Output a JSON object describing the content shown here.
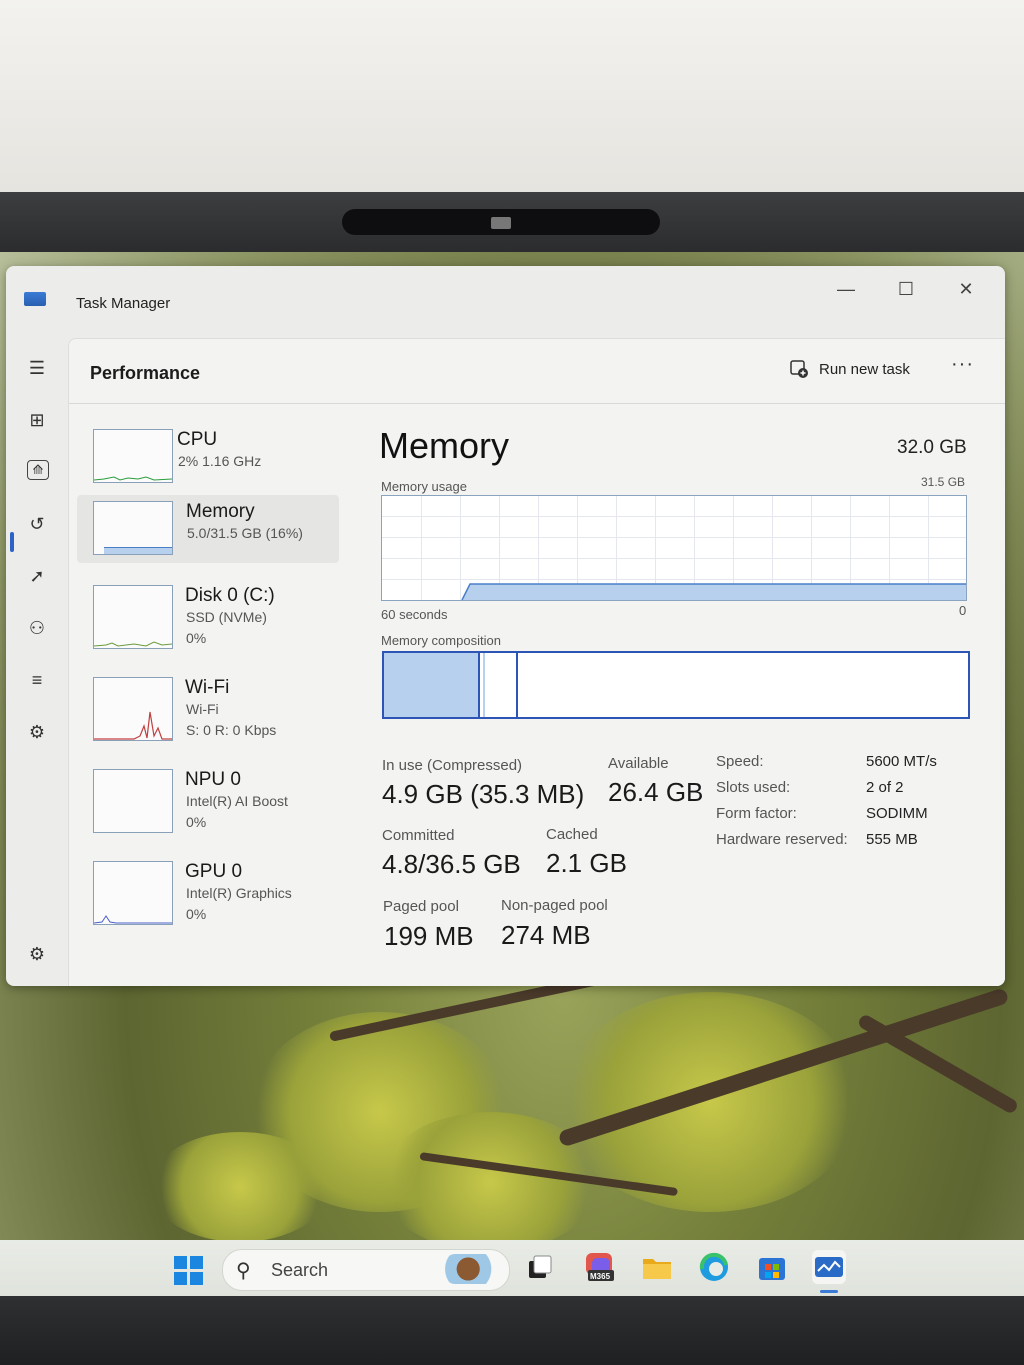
{
  "window": {
    "title": "Task Manager",
    "minimize_glyph": "—",
    "maximize_glyph": "☐",
    "close_glyph": "✕"
  },
  "nav": {
    "items": [
      {
        "name": "hamburger-menu-icon",
        "glyph": "☰"
      },
      {
        "name": "processes-icon",
        "glyph": "⊞"
      },
      {
        "name": "performance-icon",
        "glyph": "⟰",
        "selected": true
      },
      {
        "name": "app-history-icon",
        "glyph": "↺"
      },
      {
        "name": "startup-apps-icon",
        "glyph": "➚"
      },
      {
        "name": "users-icon",
        "glyph": "⚇"
      },
      {
        "name": "details-icon",
        "glyph": "≡"
      },
      {
        "name": "services-icon",
        "glyph": "⚙"
      }
    ],
    "settings_glyph": "⚙"
  },
  "header": {
    "title": "Performance",
    "run_new_task": "Run new task",
    "more_glyph": "···"
  },
  "devices": [
    {
      "name": "CPU",
      "line1": "2%  1.16 GHz",
      "line2": ""
    },
    {
      "name": "Memory",
      "line1": "5.0/31.5 GB (16%)",
      "line2": "",
      "selected": true
    },
    {
      "name": "Disk 0 (C:)",
      "line1": "SSD (NVMe)",
      "line2": "0%"
    },
    {
      "name": "Wi-Fi",
      "line1": "Wi-Fi",
      "line2": "S: 0  R: 0 Kbps"
    },
    {
      "name": "NPU 0",
      "line1": "Intel(R) AI Boost",
      "line2": "0%"
    },
    {
      "name": "GPU 0",
      "line1": "Intel(R) Graphics",
      "line2": "0%"
    }
  ],
  "memory": {
    "title": "Memory",
    "total": "32.0 GB",
    "usage_label": "Memory usage",
    "usage_max": "31.5 GB",
    "time_label": "60 seconds",
    "zero_label": "0",
    "composition_label": "Memory composition",
    "in_use_label": "In use (Compressed)",
    "in_use_value": "4.9 GB (35.3 MB)",
    "available_label": "Available",
    "available_value": "26.4 GB",
    "committed_label": "Committed",
    "committed_value": "4.8/36.5 GB",
    "cached_label": "Cached",
    "cached_value": "2.1 GB",
    "paged_label": "Paged pool",
    "paged_value": "199 MB",
    "nonpaged_label": "Non-paged pool",
    "nonpaged_value": "274 MB",
    "specs": [
      {
        "key": "Speed:",
        "value": "5600 MT/s"
      },
      {
        "key": "Slots used:",
        "value": "2 of 2"
      },
      {
        "key": "Form factor:",
        "value": "SODIMM"
      },
      {
        "key": "Hardware reserved:",
        "value": "555 MB"
      }
    ]
  },
  "taskbar": {
    "search_placeholder": "Search",
    "m365_label": "M365"
  },
  "colors": {
    "accent": "#2d55b6",
    "memory_fill": "#b6d0ee"
  }
}
